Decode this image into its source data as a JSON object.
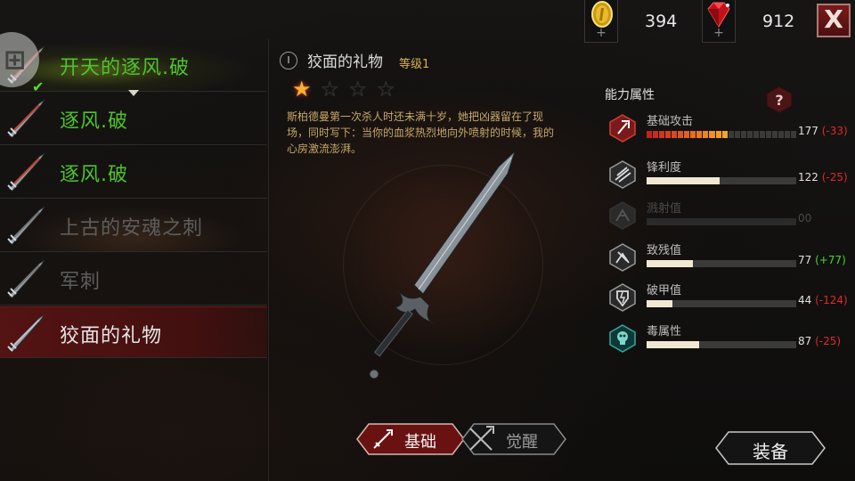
{
  "currency": {
    "gold": {
      "icon": "gold-coin-icon",
      "value": "394"
    },
    "gems": {
      "icon": "ruby-gem-icon",
      "value": "912"
    },
    "add_symbol": "+"
  },
  "close_label": "X",
  "left_circle_glyph": "⊞",
  "weapons": [
    {
      "name": "开天的逐风.破",
      "state": "equipped"
    },
    {
      "name": "逐风.破",
      "state": "normal"
    },
    {
      "name": "逐风.破",
      "state": "normal"
    },
    {
      "name": "上古的安魂之刺",
      "state": "locked"
    },
    {
      "name": "军刺",
      "state": "locked"
    },
    {
      "name": "狡面的礼物",
      "state": "selected"
    }
  ],
  "equipped_check": "✔",
  "detail": {
    "badge": "I",
    "title": "狡面的礼物",
    "level": "等级1",
    "stars_filled": 1,
    "stars_total": 4,
    "description": "斯柏德曼第一次杀人时还未满十岁，她把凶器留在了现场，同时写下：当你的血浆热烈地向外喷射的时候，我的心房激流澎湃。"
  },
  "tabs": {
    "basic": "基础",
    "awaken": "觉醒"
  },
  "equip_label": "装备",
  "stats": {
    "title": "能力属性",
    "help_symbol": "?",
    "items": [
      {
        "name": "基础攻击",
        "icon": "attack-icon",
        "value": "177",
        "delta": "(-33)",
        "delta_sign": "neg",
        "fill": 0.55,
        "segmented": true
      },
      {
        "name": "锋利度",
        "icon": "sharpness-icon",
        "value": "122",
        "delta": "(-25)",
        "delta_sign": "neg",
        "fill": 0.49
      },
      {
        "name": "溅射值",
        "icon": "splash-icon",
        "value": "00",
        "delta": "",
        "delta_sign": "",
        "fill": 0,
        "disabled": true
      },
      {
        "name": "致残值",
        "icon": "maim-icon",
        "value": "77",
        "delta": "(+77)",
        "delta_sign": "pos",
        "fill": 0.31
      },
      {
        "name": "破甲值",
        "icon": "armor-break-icon",
        "value": "44",
        "delta": "(-124)",
        "delta_sign": "neg",
        "fill": 0.17
      },
      {
        "name": "毒属性",
        "icon": "poison-skull-icon",
        "value": "87",
        "delta": "(-25)",
        "delta_sign": "neg",
        "fill": 0.35
      }
    ]
  },
  "colors": {
    "equipped_green": "#4ec42a",
    "locked_grey": "#5d5d5d",
    "selected_red": "#6e1414",
    "level_gold": "#d9b04c",
    "desc_gold": "#c9a86a"
  }
}
